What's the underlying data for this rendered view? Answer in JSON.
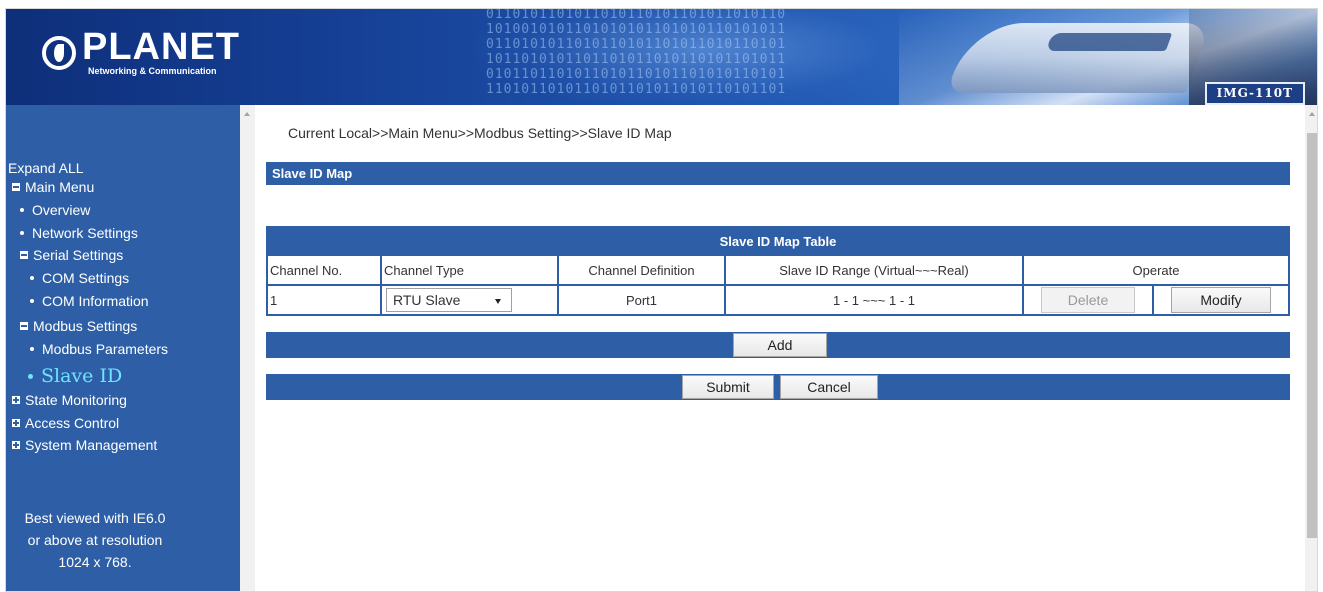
{
  "header": {
    "logo_name": "PLANET",
    "logo_subtitle": "Networking & Communication",
    "model_badge": "IMG-110T",
    "binary_text": "0110101101011010110101101011010110\n1010010101101010101101010110101011\n0110101011010110101101011010110101\n1011010101101101011010110101101011\n0101101101011010110101101010110101\n1101011010110101101011010110101101"
  },
  "sidebar": {
    "expand_all": "Expand ALL",
    "items": [
      {
        "label": "Main Menu",
        "type": "group",
        "state": "minus"
      },
      {
        "label": "Overview",
        "type": "leaf"
      },
      {
        "label": "Network Settings",
        "type": "leaf"
      },
      {
        "label": "Serial Settings",
        "type": "group",
        "state": "minus"
      },
      {
        "label": "COM Settings",
        "type": "leaf"
      },
      {
        "label": "COM Information",
        "type": "leaf"
      },
      {
        "label": "Modbus Settings",
        "type": "group",
        "state": "minus"
      },
      {
        "label": "Modbus Parameters",
        "type": "leaf"
      },
      {
        "label": "Slave ID",
        "type": "leaf",
        "active": true
      },
      {
        "label": "State Monitoring",
        "type": "group",
        "state": "plus"
      },
      {
        "label": "Access Control",
        "type": "group",
        "state": "plus"
      },
      {
        "label": "System Management",
        "type": "group",
        "state": "plus"
      }
    ],
    "note_line1": "Best viewed with IE6.0",
    "note_line2": "or above at resolution",
    "note_line3": "1024 x 768."
  },
  "main": {
    "breadcrumb": "Current Local>>Main Menu>>Modbus Setting>>Slave ID Map",
    "section_title": "Slave ID Map",
    "table": {
      "title": "Slave ID Map Table",
      "headers": [
        "Channel No.",
        "Channel Type",
        "Channel Definition",
        "Slave ID Range (Virtual~~~Real)",
        "Operate"
      ],
      "rows": [
        {
          "channel_no": "1",
          "channel_type": "RTU Slave",
          "definition": "Port1",
          "range": "1 - 1 ~~~ 1 - 1",
          "delete_label": "Delete",
          "modify_label": "Modify"
        }
      ]
    },
    "add_label": "Add",
    "submit_label": "Submit",
    "cancel_label": "Cancel"
  },
  "colors": {
    "accent_blue": "#2e5fa6",
    "active_link": "#6ee4ff"
  }
}
